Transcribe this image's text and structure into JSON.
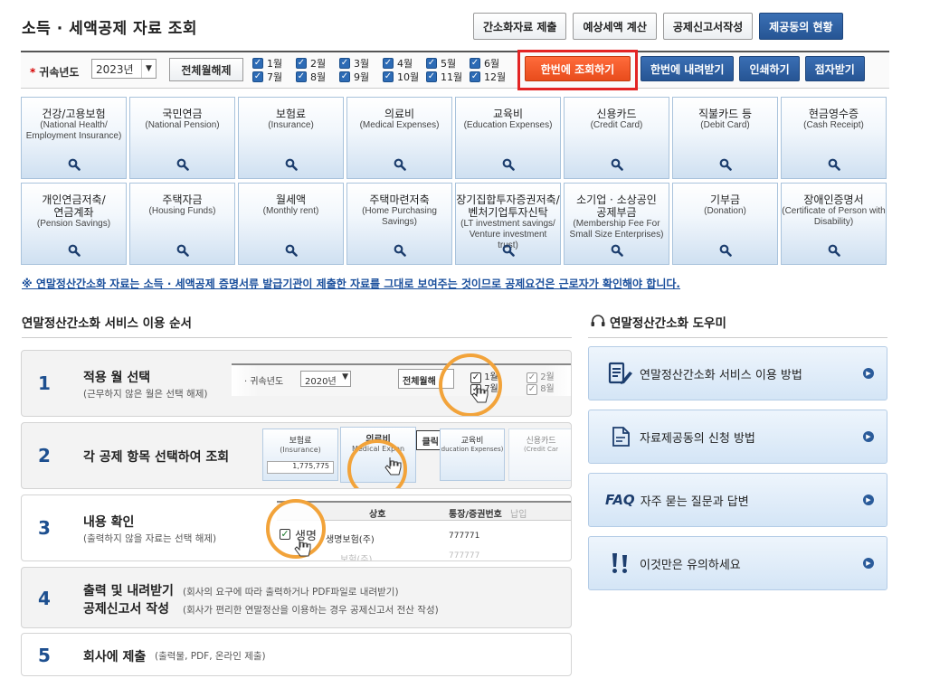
{
  "page": {
    "title": "소득 · 세액공제 자료 조회"
  },
  "top_buttons": [
    "간소화자료 제출",
    "예상세액 계산",
    "공제신고서작성",
    "제공동의 현황"
  ],
  "filter": {
    "year_label": "귀속년도",
    "year_value": "2023년",
    "clear_label": "전체월해제",
    "months": [
      "1월",
      "2월",
      "3월",
      "4월",
      "5월",
      "6월",
      "7월",
      "8월",
      "9월",
      "10월",
      "11월",
      "12월"
    ],
    "checked": [
      true,
      true,
      true,
      true,
      true,
      true,
      true,
      true,
      true,
      true,
      true,
      true
    ]
  },
  "action_buttons": {
    "query_all": "한번에 조회하기",
    "download_all": "한번에 내려받기",
    "print": "인쇄하기",
    "braille": "점자받기"
  },
  "categories": [
    {
      "kr": [
        "건강/고용보험"
      ],
      "en": [
        "(National Health/",
        "Employment Insurance)"
      ]
    },
    {
      "kr": [
        "국민연금"
      ],
      "en": [
        "(National Pension)"
      ]
    },
    {
      "kr": [
        "보험료"
      ],
      "en": [
        "(Insurance)"
      ]
    },
    {
      "kr": [
        "의료비"
      ],
      "en": [
        "(Medical Expenses)"
      ]
    },
    {
      "kr": [
        "교육비"
      ],
      "en": [
        "(Education Expenses)"
      ]
    },
    {
      "kr": [
        "신용카드"
      ],
      "en": [
        "(Credit Card)"
      ]
    },
    {
      "kr": [
        "직불카드 등"
      ],
      "en": [
        "(Debit Card)"
      ]
    },
    {
      "kr": [
        "현금영수증"
      ],
      "en": [
        "(Cash Receipt)"
      ]
    },
    {
      "kr": [
        "개인연금저축/",
        "연금계좌"
      ],
      "en": [
        "(Pension Savings)"
      ]
    },
    {
      "kr": [
        "주택자금"
      ],
      "en": [
        "(Housing Funds)"
      ]
    },
    {
      "kr": [
        "월세액"
      ],
      "en": [
        "(Monthly rent)"
      ]
    },
    {
      "kr": [
        "주택마련저축"
      ],
      "en": [
        "(Home Purchasing",
        "Savings)"
      ]
    },
    {
      "kr": [
        "장기집합투자증권저축/",
        "벤처기업투자신탁"
      ],
      "en": [
        "(LT investment savings/",
        "Venture investment",
        "trust)"
      ]
    },
    {
      "kr": [
        "소기업 · 소상공인",
        "공제부금"
      ],
      "en": [
        "(Membership Fee For",
        "Small Size Enterprises)"
      ]
    },
    {
      "kr": [
        "기부금"
      ],
      "en": [
        "(Donation)"
      ]
    },
    {
      "kr": [
        "장애인증명서"
      ],
      "en": [
        "(Certificate of Person with",
        "Disability)"
      ]
    }
  ],
  "notice": "※ 연말정산간소화 자료는 소득 · 세액공제 증명서류 발급기관이 제출한 자료를 그대로 보여주는 것이므로 공제요건은 근로자가 확인해야 합니다.",
  "steps_section": {
    "title": "연말정산간소화 서비스 이용 순서",
    "steps": [
      {
        "num": "1",
        "title": "적용 월 선택",
        "sub": "(근무하지 않은 월은 선택 해제)"
      },
      {
        "num": "2",
        "title": "각 공제 항목 선택하여 조회",
        "sub": ""
      },
      {
        "num": "3",
        "title": "내용 확인",
        "sub": "(출력하지 않을 자료는 선택 해제)"
      },
      {
        "num": "4",
        "title": "출력 및 내려받기",
        "title2": "공제신고서 작성",
        "sub": "(회사의 요구에 따라 출력하거나 PDF파일로 내려받기)",
        "sub2": "(회사가 편리한 연말정산을 이용하는 경우 공제신고서 전산 작성)"
      },
      {
        "num": "5",
        "title": "회사에 제출",
        "sub": "(출력물, PDF, 온라인 제출)"
      }
    ],
    "mock1": {
      "year_label": "귀속년도",
      "year_value": "2020년",
      "clear": "전체월해",
      "m1": "1월",
      "m2": "2월",
      "m7": "7월",
      "m8": "8월"
    },
    "mock2": {
      "c1_kr": "보험료",
      "c1_en": "(Insurance)",
      "c1_val": "1,775,775",
      "c2_kr": "의료비",
      "c2_en": "Medical Expen",
      "c3_kr": "교육비",
      "c3_en": "ducation Expenses)",
      "c4_kr": "신용카드",
      "c4_en": "(Credit Car",
      "click": "클릭!"
    },
    "mock3": {
      "h1": "상호",
      "h2": "통장/증권번호",
      "h3": "납입",
      "row1": "생명보험(주)",
      "row1_name": "생명",
      "row1_no": "777771",
      "row2": "보험(주)",
      "row2_no": "777777"
    }
  },
  "help": {
    "title": "연말정산간소화 도우미",
    "items": [
      {
        "label": "연말정산간소화 서비스 이용 방법",
        "icon": "document-pen-icon"
      },
      {
        "label": "자료제공동의 신청 방법",
        "icon": "document-icon"
      },
      {
        "label": "자주 묻는 질문과 답변",
        "icon_text": "FAQ",
        "icon": "faq-icon"
      },
      {
        "label": "이것만은 유의하세요",
        "icon": "exclamation-icon"
      }
    ]
  },
  "colors": {
    "accent_navy": "#265594",
    "accent_orange": "#e84c1c",
    "highlight_red": "#e32424",
    "step_number": "#1d4f8f",
    "ring_orange": "#f2a33a"
  }
}
